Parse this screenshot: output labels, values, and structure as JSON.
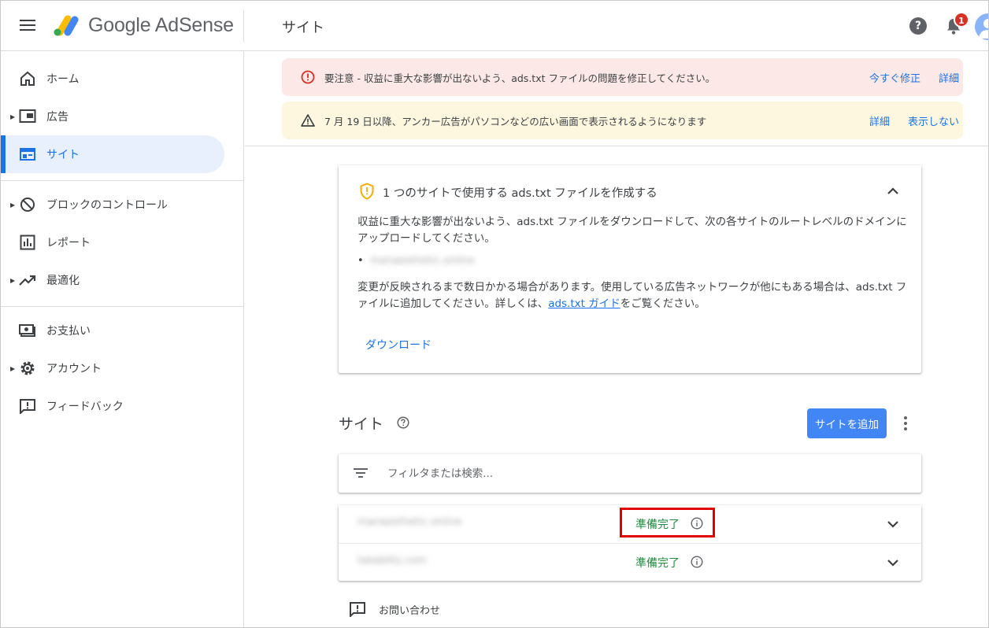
{
  "header": {
    "brand": "Google AdSense",
    "page_title": "サイト",
    "help_glyph": "?",
    "notification_count": "1",
    "icons": {
      "menu": "hamburger-icon",
      "logo": "adsense-logo",
      "help": "help-icon",
      "bell": "notifications-icon",
      "avatar": "account-avatar"
    }
  },
  "sidebar": {
    "items": [
      {
        "label": "ホーム",
        "icon": "home-icon",
        "expandable": false,
        "active": false
      },
      {
        "label": "広告",
        "icon": "ads-icon",
        "expandable": true,
        "active": false
      },
      {
        "label": "サイト",
        "icon": "sites-icon",
        "expandable": false,
        "active": true
      },
      {
        "label": "ブロックのコントロール",
        "icon": "block-icon",
        "expandable": true,
        "active": false
      },
      {
        "label": "レポート",
        "icon": "reports-icon",
        "expandable": false,
        "active": false
      },
      {
        "label": "最適化",
        "icon": "optimization-icon",
        "expandable": true,
        "active": false
      },
      {
        "label": "お支払い",
        "icon": "payments-icon",
        "expandable": false,
        "active": false
      },
      {
        "label": "アカウント",
        "icon": "account-gear-icon",
        "expandable": true,
        "active": false
      },
      {
        "label": "フィードバック",
        "icon": "feedback-icon",
        "expandable": false,
        "active": false
      }
    ],
    "arrow_glyph": "▶"
  },
  "banners": {
    "error": {
      "text": "要注意 - 収益に重大な影響が出ないよう、ads.txt ファイルの問題を修正してください。",
      "action_fix": "今すぐ修正",
      "action_details": "詳細",
      "color": "#fce8e6"
    },
    "warning": {
      "text": "7 月 19 日以降、アンカー広告がパソコンなどの広い画面で表示されるようになります",
      "action_details": "詳細",
      "action_hide": "表示しない",
      "color": "#fef7e0"
    }
  },
  "ads_card": {
    "title": "1 つのサイトで使用する ads.txt ファイルを作成する",
    "paragraph1": "収益に重大な影響が出ないよう、ads.txt ファイルをダウンロードして、次の各サイトのルートレベルのドメインにアップロードしてください。",
    "bullet_glyph": "•",
    "site": "manaesthetic.online",
    "paragraph2_before": "変更が反映されるまで数日かかる場合があります。使用している広告ネットワークが他にもある場合は、ads.txt ファイルに追加してください。詳しくは、",
    "paragraph2_link": "ads.txt ガイド",
    "paragraph2_after": "をご覧ください。",
    "download": "ダウンロード"
  },
  "sites": {
    "title": "サイト",
    "add_button": "サイトを追加",
    "filter_placeholder": "フィルタまたは検索...",
    "rows": [
      {
        "site": "manaesthetic.online",
        "status": "準備完了"
      },
      {
        "site": "takablitz.com",
        "status": "準備完了"
      }
    ],
    "status_color": "#1e8e3e"
  },
  "footer": {
    "contact": "お問い合わせ"
  },
  "colors": {
    "accent": "#1a73e8",
    "button": "#4285f4",
    "error_icon": "#d93025",
    "highlight_box": "#e00000"
  }
}
